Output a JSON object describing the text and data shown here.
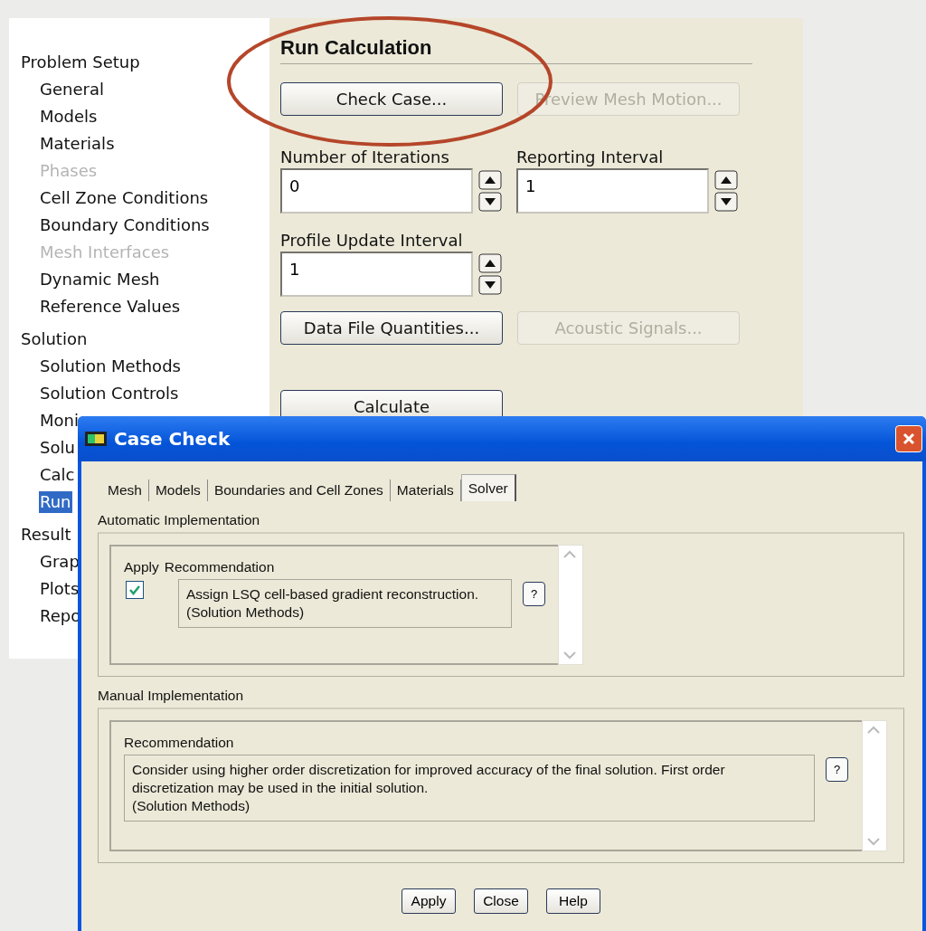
{
  "navigation_tree": [
    {
      "label": "Problem Setup",
      "children": [
        {
          "label": "General",
          "disabled": false,
          "selected": false
        },
        {
          "label": "Models",
          "disabled": false,
          "selected": false
        },
        {
          "label": "Materials",
          "disabled": false,
          "selected": false
        },
        {
          "label": "Phases",
          "disabled": true,
          "selected": false
        },
        {
          "label": "Cell Zone Conditions",
          "disabled": false,
          "selected": false
        },
        {
          "label": "Boundary Conditions",
          "disabled": false,
          "selected": false
        },
        {
          "label": "Mesh Interfaces",
          "disabled": true,
          "selected": false
        },
        {
          "label": "Dynamic Mesh",
          "disabled": false,
          "selected": false
        },
        {
          "label": "Reference Values",
          "disabled": false,
          "selected": false
        }
      ]
    },
    {
      "label": "Solution",
      "children": [
        {
          "label": "Solution Methods",
          "disabled": false,
          "selected": false
        },
        {
          "label": "Solution Controls",
          "disabled": false,
          "selected": false
        },
        {
          "label": "Moni",
          "disabled": false,
          "selected": false
        },
        {
          "label": "Solu",
          "disabled": false,
          "selected": false
        },
        {
          "label": "Calc",
          "disabled": false,
          "selected": false
        },
        {
          "label": "Run",
          "disabled": false,
          "selected": true
        }
      ]
    },
    {
      "label": "Result",
      "children": [
        {
          "label": "Grap",
          "disabled": false,
          "selected": false
        },
        {
          "label": "Plots",
          "disabled": false,
          "selected": false
        },
        {
          "label": "Repo",
          "disabled": false,
          "selected": false
        }
      ]
    }
  ],
  "run_calculation": {
    "title": "Run Calculation",
    "top_buttons": [
      {
        "label": "Check Case...",
        "disabled": false
      },
      {
        "label": "Preview Mesh Motion...",
        "disabled": true
      }
    ],
    "fields": [
      {
        "label": "Number of Iterations",
        "value": "0"
      },
      {
        "label": "Reporting Interval",
        "value": "1"
      },
      {
        "label": "Profile Update Interval",
        "value": "1"
      }
    ],
    "lower_buttons": [
      {
        "label": "Data File Quantities...",
        "disabled": false
      },
      {
        "label": "Acoustic Signals...",
        "disabled": true
      }
    ],
    "calculate_button": "Calculate"
  },
  "case_check_dialog": {
    "title": "Case Check",
    "tabs": [
      {
        "label": "Mesh",
        "selected": false
      },
      {
        "label": "Models",
        "selected": false
      },
      {
        "label": "Boundaries and Cell Zones",
        "selected": false
      },
      {
        "label": "Materials",
        "selected": false
      },
      {
        "label": "Solver",
        "selected": true
      }
    ],
    "automatic": {
      "heading": "Automatic Implementation",
      "apply_header": "Apply",
      "recommendation_header": "Recommendation",
      "items": [
        {
          "checked": true,
          "text": "Assign LSQ cell-based gradient reconstruction.\n(Solution Methods)",
          "help": "?"
        }
      ]
    },
    "manual": {
      "heading": "Manual Implementation",
      "recommendation_header": "Recommendation",
      "items": [
        {
          "text": "Consider using higher order discretization for improved accuracy of the final solution. First order discretization may be used in the initial solution.\n(Solution Methods)",
          "help": "?"
        }
      ]
    },
    "buttons": [
      "Apply",
      "Close",
      "Help"
    ]
  }
}
